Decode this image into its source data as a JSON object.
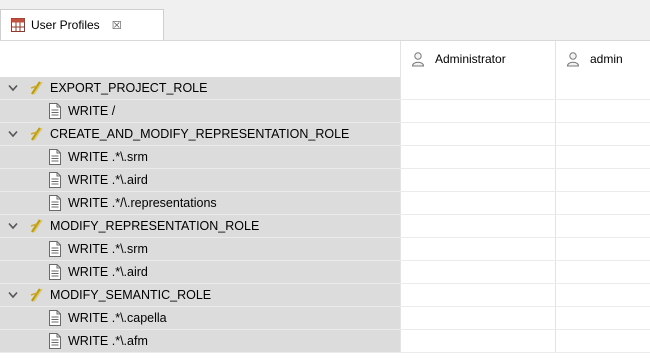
{
  "tab": {
    "title": "User Profiles",
    "close": "☒"
  },
  "columns": [
    {
      "name": "Administrator"
    },
    {
      "name": "admin"
    }
  ],
  "rows": [
    {
      "type": "role",
      "label": "EXPORT_PROJECT_ROLE"
    },
    {
      "type": "perm",
      "label": "WRITE /"
    },
    {
      "type": "role",
      "label": "CREATE_AND_MODIFY_REPRESENTATION_ROLE"
    },
    {
      "type": "perm",
      "label": "WRITE .*\\.srm"
    },
    {
      "type": "perm",
      "label": "WRITE .*\\.aird"
    },
    {
      "type": "perm",
      "label": "WRITE .*/\\.representations"
    },
    {
      "type": "role",
      "label": "MODIFY_REPRESENTATION_ROLE"
    },
    {
      "type": "perm",
      "label": "WRITE .*\\.srm"
    },
    {
      "type": "perm",
      "label": "WRITE .*\\.aird"
    },
    {
      "type": "role",
      "label": "MODIFY_SEMANTIC_ROLE"
    },
    {
      "type": "perm",
      "label": "WRITE .*\\.capella"
    },
    {
      "type": "perm",
      "label": "WRITE .*\\.afm"
    }
  ]
}
